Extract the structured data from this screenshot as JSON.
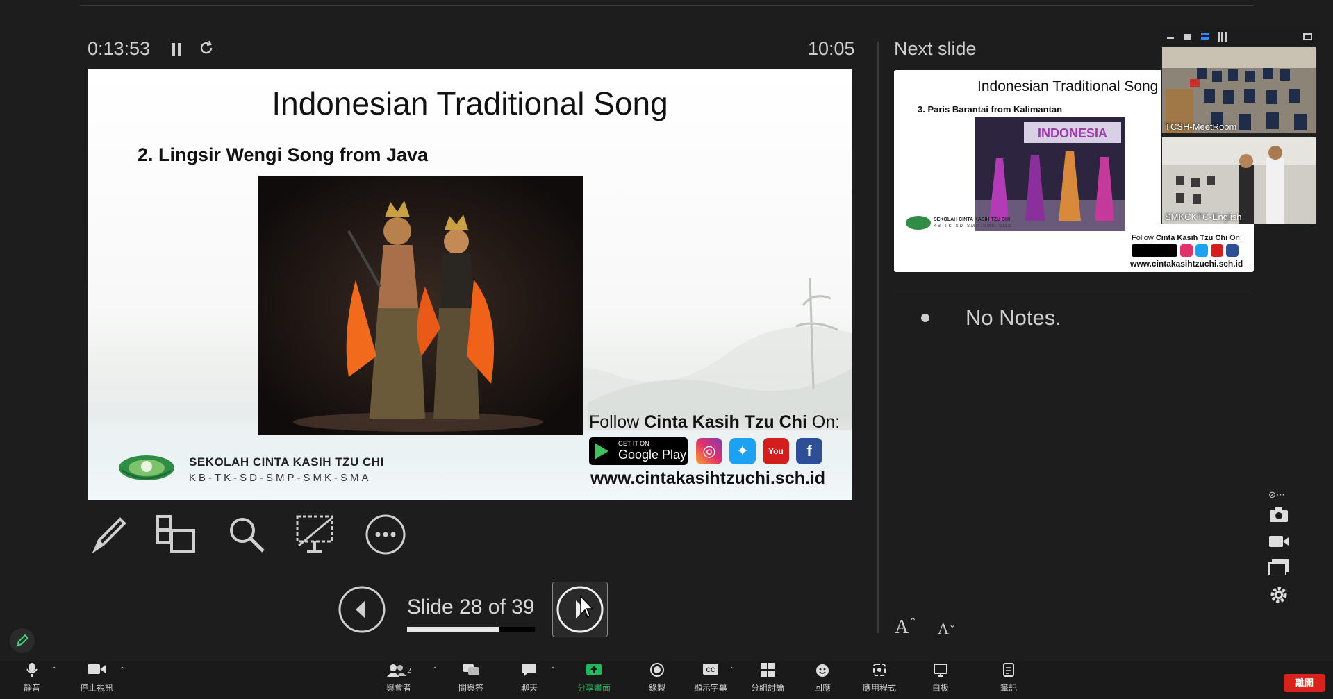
{
  "presenter": {
    "elapsed_time": "0:13:53",
    "clock": "10:05",
    "next_slide_label": "Next slide",
    "slide_counter": "Slide 28 of 39",
    "progress_fraction": 0.72,
    "notes": "No Notes."
  },
  "current_slide": {
    "title": "Indonesian Traditional Song",
    "subtitle": "2. Lingsir Wengi Song from Java",
    "school_name": "SEKOLAH CINTA KASIH TZU CHI",
    "school_levels": "KB-TK-SD-SMP-SMK-SMA",
    "follow_prefix": "Follow ",
    "follow_brand": "Cinta Kasih Tzu Chi",
    "follow_suffix": " On:",
    "google_play_small": "GET IT ON",
    "google_play_big": "Google Play",
    "url": "www.cintakasihtzuchi.sch.id"
  },
  "next_slide": {
    "title": "Indonesian Traditional Song",
    "subtitle": "3. Paris Barantai from Kalimantan",
    "banner_text": "INDONESIA",
    "follow_prefix": "Follow ",
    "follow_brand": "Cinta Kasih Tzu Chi",
    "follow_suffix": " On:",
    "school_name": "SEKOLAH CINTA KASIH TZU CHI",
    "school_levels": "KB-TK-SD-SMP-SMK-SMA",
    "url": "www.cintakasihtzuchi.sch.id"
  },
  "gallery": {
    "participants": [
      {
        "name": "TCSH-MeetRoom"
      },
      {
        "name": "SMKCKTC-English"
      }
    ]
  },
  "toolbar": {
    "mute": "靜音",
    "stop_video": "停止視訊",
    "participants": "與會者",
    "participants_count": "2",
    "qa": "問與答",
    "chat": "聊天",
    "share_screen": "分享畫面",
    "record": "錄製",
    "captions": "顯示字幕",
    "breakout": "分組討論",
    "reactions": "回應",
    "apps": "應用程式",
    "whiteboard": "白板",
    "notes": "筆記",
    "end": "離開"
  },
  "colors": {
    "background": "#1d1d1e",
    "share_green": "#1fb85a",
    "end_red": "#d7231b",
    "text": "#cfcfcf"
  }
}
